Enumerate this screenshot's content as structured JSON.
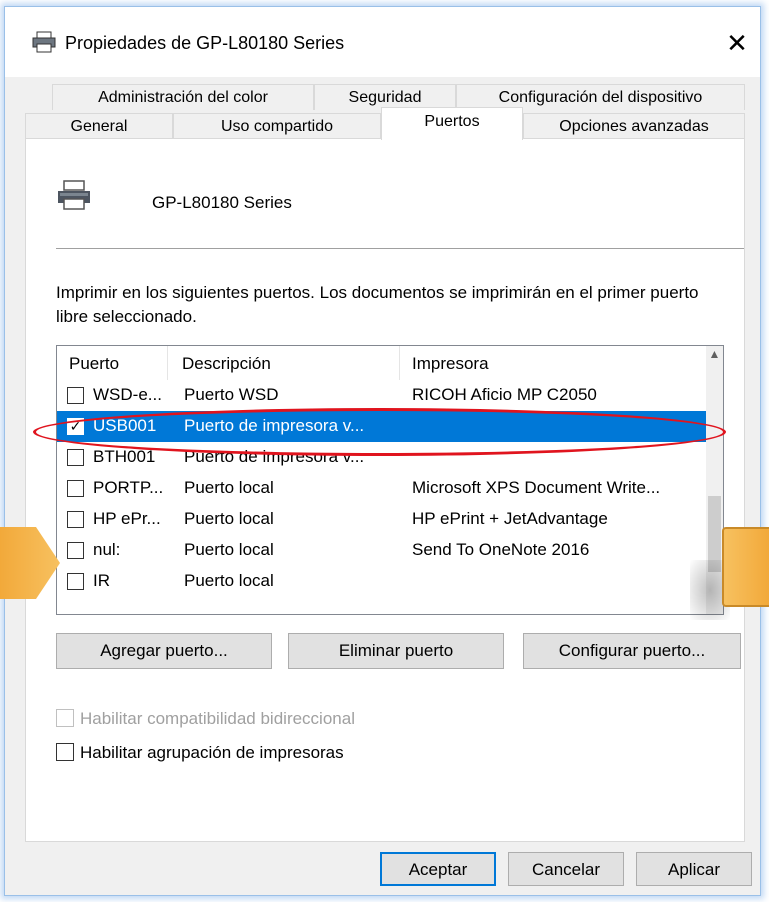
{
  "window": {
    "title": "Propiedades de GP-L80180 Series",
    "close_glyph": "✕"
  },
  "tabs": {
    "row1": [
      "Administración del color",
      "Seguridad",
      "Configuración del dispositivo"
    ],
    "row2": [
      "General",
      "Uso compartido",
      "Puertos",
      "Opciones avanzadas"
    ],
    "active": "Puertos"
  },
  "printer": {
    "name": "GP-L80180 Series",
    "icon": "printer-icon"
  },
  "description": "Imprimir en los siguientes puertos. Los documentos se imprimirán en el primer puerto libre seleccionado.",
  "ports": {
    "headers": [
      "Puerto",
      "Descripción",
      "Impresora"
    ],
    "rows": [
      {
        "port": "WSD-e...",
        "desc": "Puerto WSD",
        "printer": "RICOH Aficio MP C2050",
        "checked": false,
        "selected": false
      },
      {
        "port": "USB001",
        "desc": "Puerto de impresora v...",
        "printer": "",
        "checked": true,
        "selected": true
      },
      {
        "port": "BTH001",
        "desc": "Puerto de impresora v...",
        "printer": "",
        "checked": false,
        "selected": false
      },
      {
        "port": "PORTP...",
        "desc": "Puerto local",
        "printer": "Microsoft XPS Document Write...",
        "checked": false,
        "selected": false
      },
      {
        "port": "HP ePr...",
        "desc": "Puerto local",
        "printer": "HP ePrint + JetAdvantage",
        "checked": false,
        "selected": false
      },
      {
        "port": "nul:",
        "desc": "Puerto local",
        "printer": "Send To OneNote 2016",
        "checked": false,
        "selected": false
      },
      {
        "port": "IR",
        "desc": "Puerto local",
        "printer": "",
        "checked": false,
        "selected": false
      }
    ]
  },
  "buttons": {
    "add_port": "Agregar puerto...",
    "delete_port": "Eliminar puerto",
    "configure_port": "Configurar puerto...",
    "ok": "Aceptar",
    "cancel": "Cancelar",
    "apply": "Aplicar"
  },
  "options": {
    "bidirectional": "Habilitar compatibilidad bidireccional",
    "pooling": "Habilitar agrupación de impresoras"
  },
  "colors": {
    "selection": "#0078d7",
    "annotation": "#e0141e",
    "arrow": "#f2a93a"
  }
}
